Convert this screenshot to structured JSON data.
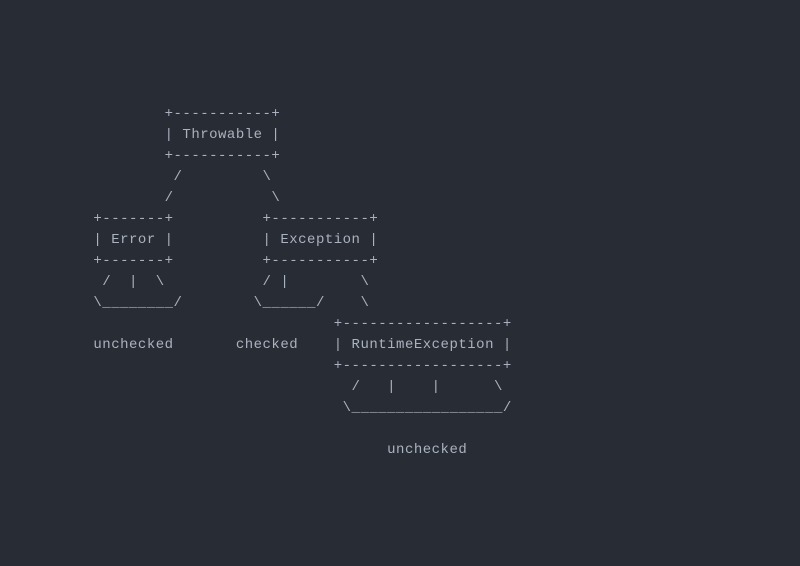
{
  "diagram": {
    "ascii": "              +-----------+\n              | Throwable |\n              +-----------+\n               /         \\\n              /           \\\n      +-------+          +-----------+\n      | Error |          | Exception |\n      +-------+          +-----------+\n       /  |  \\           / |        \\\n      \\________/        \\______/    \\\n                                 +------------------+\n      unchecked       checked    | RuntimeException |\n                                 +------------------+\n                                   /   |    |      \\\n                                  \\_________________/\n\n                                       unchecked"
  },
  "nodes": {
    "root": "Throwable",
    "left": "Error",
    "right": "Exception",
    "right_child": "RuntimeException"
  },
  "labels": {
    "error_type": "unchecked",
    "exception_type": "checked",
    "runtime_exception_type": "unchecked"
  }
}
